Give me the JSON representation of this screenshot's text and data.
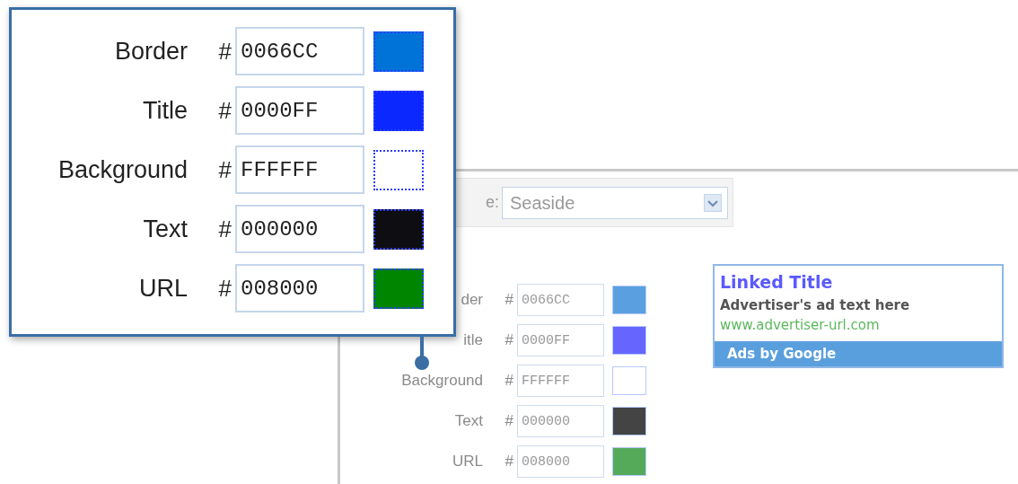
{
  "callout": {
    "rows": [
      {
        "label": "Border",
        "hash": "#",
        "value": "0066CC",
        "color": "#0073d9"
      },
      {
        "label": "Title",
        "hash": "#",
        "value": "0000FF",
        "color": "#0a28ff"
      },
      {
        "label": "Background",
        "hash": "#",
        "value": "FFFFFF",
        "color": "#ffffff"
      },
      {
        "label": "Text",
        "hash": "#",
        "value": "000000",
        "color": "#0d0d12"
      },
      {
        "label": "URL",
        "hash": "#",
        "value": "008000",
        "color": "#008500"
      }
    ]
  },
  "settings": {
    "palette": {
      "label": "e:",
      "value": "Seaside"
    },
    "rows": [
      {
        "label": "der",
        "hash": "#",
        "value": "0066CC",
        "color": "#5aa0e0"
      },
      {
        "label": "itle",
        "hash": "#",
        "value": "0000FF",
        "color": "#6666ff"
      },
      {
        "label": "Background",
        "hash": "#",
        "value": "FFFFFF",
        "color": "#ffffff"
      },
      {
        "label": "Text",
        "hash": "#",
        "value": "000000",
        "color": "#444444"
      },
      {
        "label": "URL",
        "hash": "#",
        "value": "008000",
        "color": "#55aa5a"
      }
    ]
  },
  "ad_preview": {
    "title": "Linked Title",
    "text": "Advertiser's ad text here",
    "url": "www.advertiser-url.com",
    "footer": "Ads by Google"
  }
}
